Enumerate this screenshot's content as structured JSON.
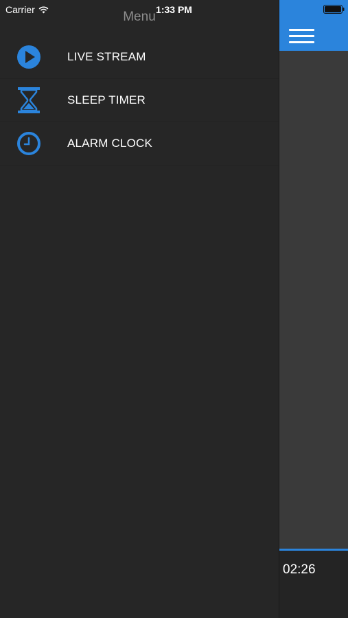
{
  "status_bar": {
    "carrier": "Carrier",
    "time": "1:33 PM",
    "icons": [
      "wifi-icon",
      "battery-icon"
    ]
  },
  "menu": {
    "title": "Menu",
    "items": [
      {
        "label": "LIVE STREAM",
        "icon": "play-circle-icon"
      },
      {
        "label": "SLEEP TIMER",
        "icon": "hourglass-icon"
      },
      {
        "label": "ALARM CLOCK",
        "icon": "clock-icon"
      }
    ]
  },
  "main": {
    "nav_icon": "hamburger-icon",
    "player": {
      "elapsed": "02:26"
    }
  },
  "colors": {
    "accent": "#2b84dc",
    "menu_background": "#262626",
    "content_background": "#3a3a3a",
    "menu_title": "#8e8e8e"
  }
}
